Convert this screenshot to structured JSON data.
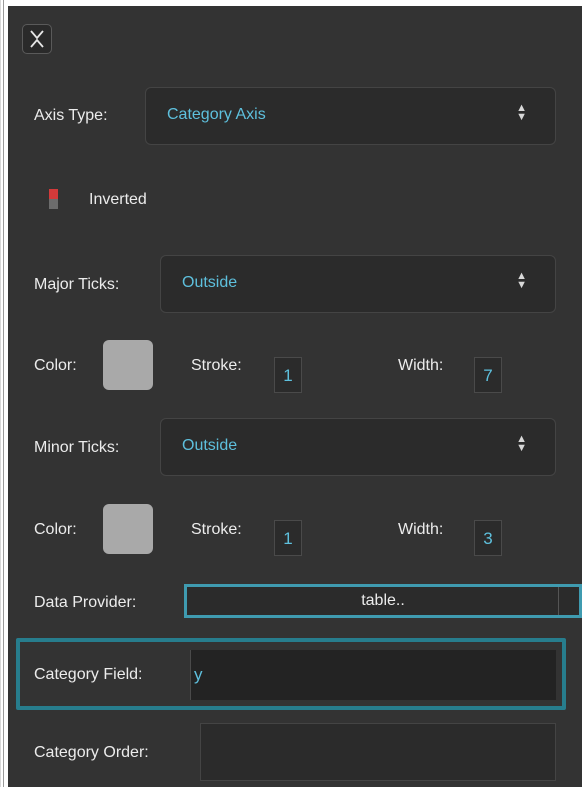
{
  "collapse_icon": "chevron-collapse-icon",
  "axis_type": {
    "label": "Axis Type:",
    "value": "Category Axis"
  },
  "inverted": {
    "label": "Inverted",
    "on": false
  },
  "major_ticks": {
    "label": "Major Ticks:",
    "value": "Outside",
    "color_label": "Color:",
    "color": "#a9a9a9",
    "stroke_label": "Stroke:",
    "stroke": "1",
    "width_label": "Width:",
    "width": "7"
  },
  "minor_ticks": {
    "label": "Minor Ticks:",
    "value": "Outside",
    "color_label": "Color:",
    "color": "#a9a9a9",
    "stroke_label": "Stroke:",
    "stroke": "1",
    "width_label": "Width:",
    "width": "3"
  },
  "data_provider": {
    "label": "Data Provider:",
    "value": "table.."
  },
  "category_field": {
    "label": "Category Field:",
    "value": "y"
  },
  "category_order": {
    "label": "Category Order:",
    "value": ""
  },
  "colors": {
    "accent": "#5ec0dd",
    "highlight": "#277d8d",
    "panel": "#333333",
    "toggle_on": "#d23a3a"
  }
}
